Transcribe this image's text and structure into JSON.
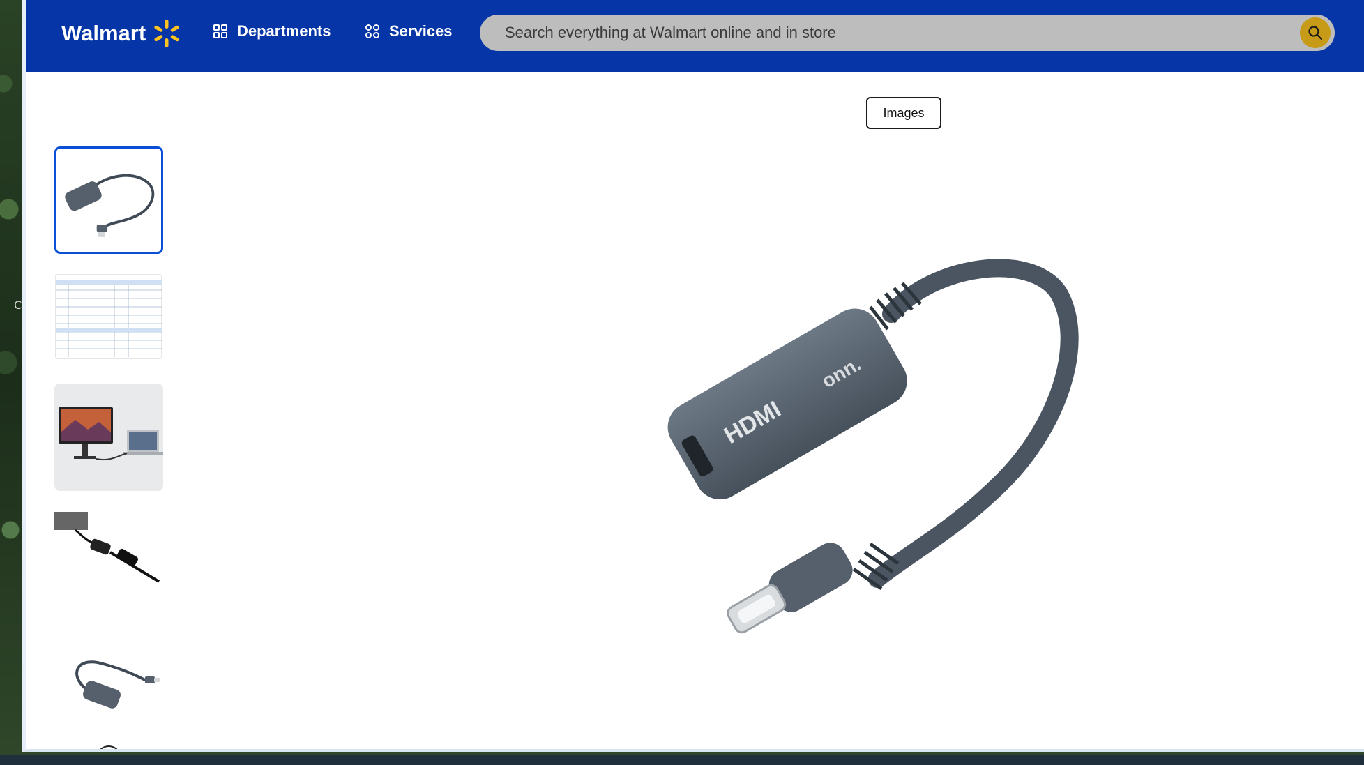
{
  "desktop": {
    "glyph": "C"
  },
  "header": {
    "brand": "Walmart",
    "departments_label": "Departments",
    "services_label": "Services",
    "search_placeholder": "Search everything at Walmart online and in store",
    "brand_color": "#0535a6",
    "spark_color": "#ffc220"
  },
  "gallery": {
    "images_label": "Images",
    "selected_index": 0,
    "thumbnails": [
      {
        "label": "adapter-angled",
        "selected": true
      },
      {
        "label": "compatibility-chart",
        "selected": false
      },
      {
        "label": "monitor-laptop-setup",
        "selected": false
      },
      {
        "label": "adapter-connected",
        "selected": false
      },
      {
        "label": "adapter-side-view",
        "selected": false
      }
    ],
    "hero_label": "HDMI",
    "hero_brand": "onn."
  }
}
